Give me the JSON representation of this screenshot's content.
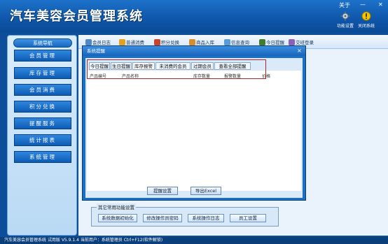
{
  "window": {
    "title": "汽车美容会员管理系统",
    "about": "关于",
    "minimize": "—",
    "close": "✕"
  },
  "top_buttons": [
    {
      "label": "功能设置",
      "icon": "gear-icon"
    },
    {
      "label": "关闭系统",
      "icon": "warning-icon"
    }
  ],
  "sidebar": {
    "header": "系统导航",
    "items": [
      {
        "label": "会员管理"
      },
      {
        "label": "库存管理"
      },
      {
        "label": "会员消费"
      },
      {
        "label": "积分兑换"
      },
      {
        "label": "提醒服务"
      },
      {
        "label": "统计报表"
      },
      {
        "label": "系统管理"
      }
    ]
  },
  "toolbar": {
    "items": [
      {
        "label": "会员日志",
        "color": "#4f88c9"
      },
      {
        "label": "普通消费",
        "color": "#e3a11c"
      },
      {
        "label": "积分兑换",
        "color": "#c9442b"
      },
      {
        "label": "商品入库",
        "color": "#d78d2a"
      },
      {
        "label": "信息查询",
        "color": "#5a9bd5"
      },
      {
        "label": "今日提醒",
        "color": "#3d7d2c"
      },
      {
        "label": "交班登录",
        "color": "#8b5fb8"
      }
    ]
  },
  "dialog": {
    "title": "系统提醒",
    "close": "×",
    "tabs": [
      {
        "label": "今日提醒"
      },
      {
        "label": "生日提醒"
      },
      {
        "label": "库存报警"
      },
      {
        "label": "未消费的会员"
      },
      {
        "label": "过期会员"
      },
      {
        "label": "查看全部提醒"
      }
    ],
    "active_tab": "库存报警",
    "columns": [
      "产品编号",
      "产品名称",
      "库存数量",
      "报警数量",
      "价格"
    ],
    "buttons": {
      "settings": "提醒设置",
      "export": "导出Excel"
    }
  },
  "bottom": {
    "legend": "其它常用功能设置",
    "buttons": [
      {
        "label": "系统数据初始化"
      },
      {
        "label": "修改操作员密码"
      },
      {
        "label": "系统操作日志"
      },
      {
        "label": "员工设置"
      }
    ]
  },
  "status_bar": {
    "text": "汽车美容会员管理系统 试用版 V5.9.1.4  当前用户：系统管理员   Ctrl+F12(软件解锁)"
  },
  "colors": {
    "brand_blue": "#0c4e99",
    "highlight_red": "#a8262e"
  }
}
